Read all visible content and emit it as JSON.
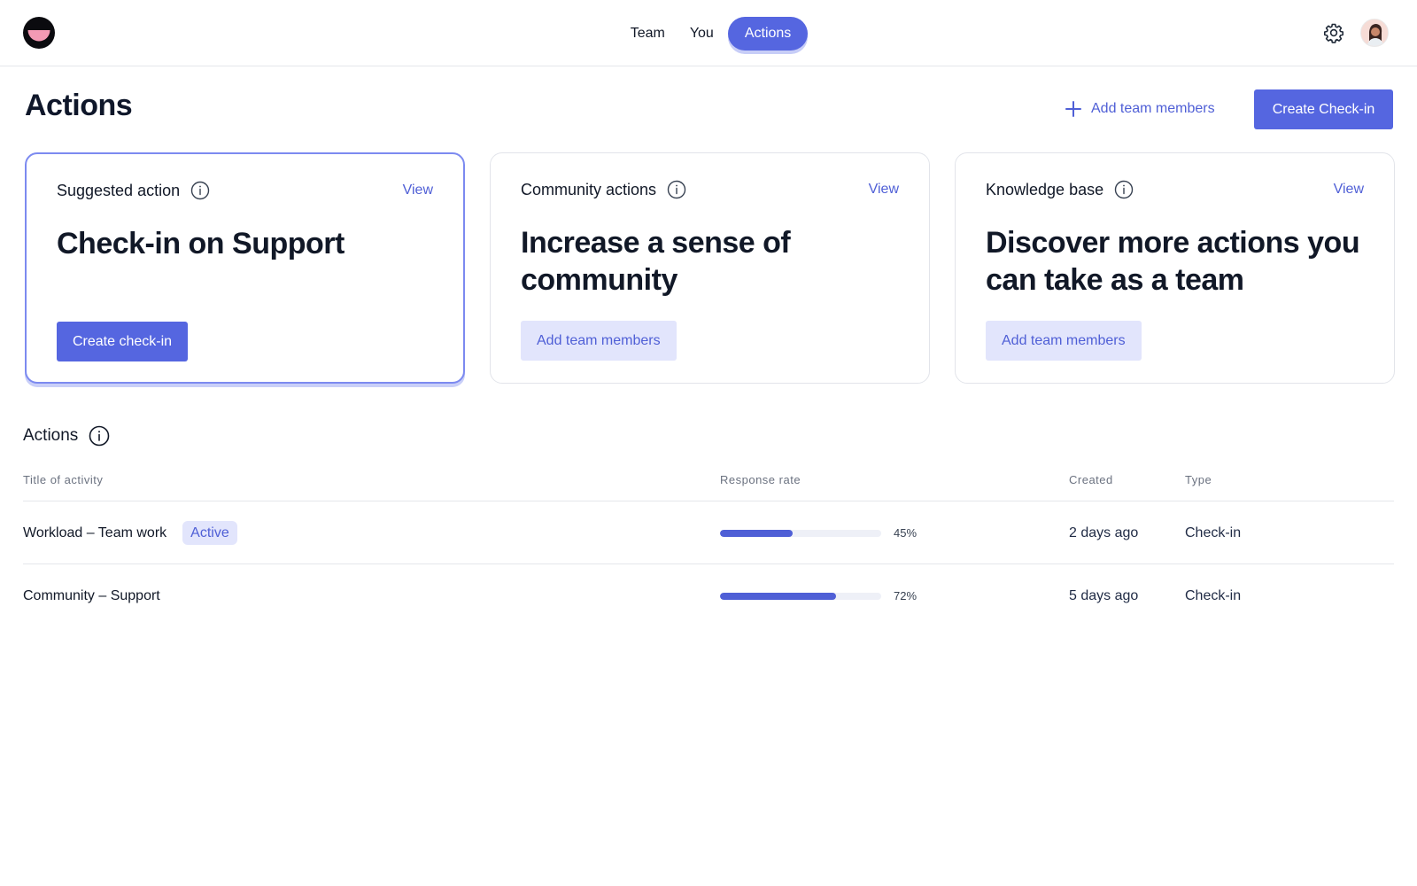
{
  "nav": {
    "items": [
      {
        "label": "Team",
        "active": false
      },
      {
        "label": "You",
        "active": false
      },
      {
        "label": "Actions",
        "active": true
      }
    ]
  },
  "header": {
    "title": "Actions",
    "add_members_label": "Add team members",
    "create_checkin_label": "Create Check-in"
  },
  "cards": [
    {
      "label": "Suggested action",
      "view": "View",
      "title": "Check-in on Support",
      "button": "Create check-in",
      "selected": true
    },
    {
      "label": "Community actions",
      "view": "View",
      "title": "Increase a sense of community",
      "button": "Add team members",
      "selected": false
    },
    {
      "label": "Knowledge base",
      "view": "View",
      "title": "Discover more actions you can take as a team",
      "button": "Add team members",
      "selected": false
    }
  ],
  "section": {
    "title": "Actions",
    "columns": {
      "title": "Title of activity",
      "response": "Response rate",
      "created": "Created",
      "type": "Type"
    },
    "rows": [
      {
        "title": "Workload – Team work",
        "badge": "Active",
        "response_pct": 45,
        "response_label": "45%",
        "created": "2 days ago",
        "type": "Check-in"
      },
      {
        "title": "Community –  Support",
        "badge": "",
        "response_pct": 72,
        "response_label": "72%",
        "created": "5 days ago",
        "type": "Check-in"
      }
    ]
  },
  "colors": {
    "accent": "#5566e0",
    "accent_soft": "#e2e5fc",
    "link": "#4f5fd6"
  },
  "icons": {
    "logo": "smile-logo-icon",
    "settings": "gear-icon",
    "avatar": "user-avatar",
    "add": "plus-icon",
    "info": "info-icon"
  }
}
